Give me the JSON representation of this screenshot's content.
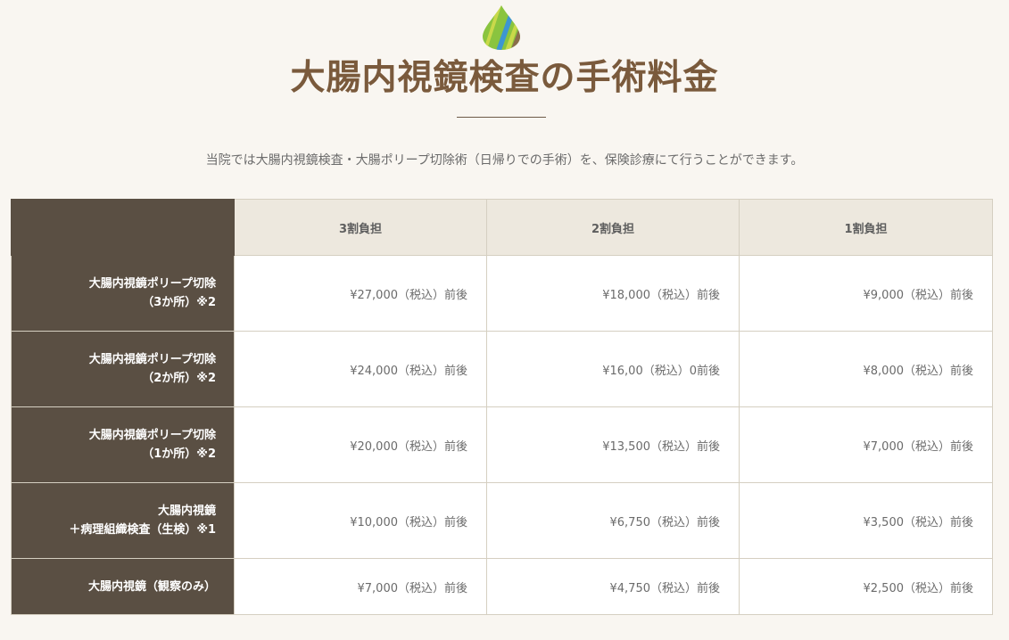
{
  "header": {
    "title": "大腸内視鏡検査の手術料金",
    "intro": "当院では大腸内視鏡検査・大腸ポリープ切除術（日帰りでの手術）を、保険診療にて行うことができます。"
  },
  "logo": {
    "icon": "leaf-drop-logo",
    "colors": [
      "#8ac43f",
      "#3d96d3",
      "#8a6d4b"
    ]
  },
  "table": {
    "columns": [
      "3割負担",
      "2割負担",
      "1割負担"
    ],
    "rows": [
      {
        "label": [
          "大腸内視鏡ポリープ切除",
          "（3か所）※2"
        ],
        "prices": [
          "¥27,000（税込）前後",
          "¥18,000（税込）前後",
          "¥9,000（税込）前後"
        ]
      },
      {
        "label": [
          "大腸内視鏡ポリープ切除",
          "（2か所）※2"
        ],
        "prices": [
          "¥24,000（税込）前後",
          "¥16,00（税込）0前後",
          "¥8,000（税込）前後"
        ]
      },
      {
        "label": [
          "大腸内視鏡ポリープ切除",
          "（1か所）※2"
        ],
        "prices": [
          "¥20,000（税込）前後",
          "¥13,500（税込）前後",
          "¥7,000（税込）前後"
        ]
      },
      {
        "label": [
          "大腸内視鏡",
          "＋病理組織検査（生検）※1"
        ],
        "prices": [
          "¥10,000（税込）前後",
          "¥6,750（税込）前後",
          "¥3,500（税込）前後"
        ]
      },
      {
        "label": [
          "大腸内視鏡（観察のみ）"
        ],
        "prices": [
          "¥7,000（税込）前後",
          "¥4,750（税込）前後",
          "¥2,500（税込）前後"
        ]
      }
    ]
  },
  "colors": {
    "background": "#f9f6f1",
    "title": "#7a5a3c",
    "row_header_bg": "#5a4f43",
    "column_header_bg": "#ede8de",
    "border": "#d5cfc1"
  }
}
